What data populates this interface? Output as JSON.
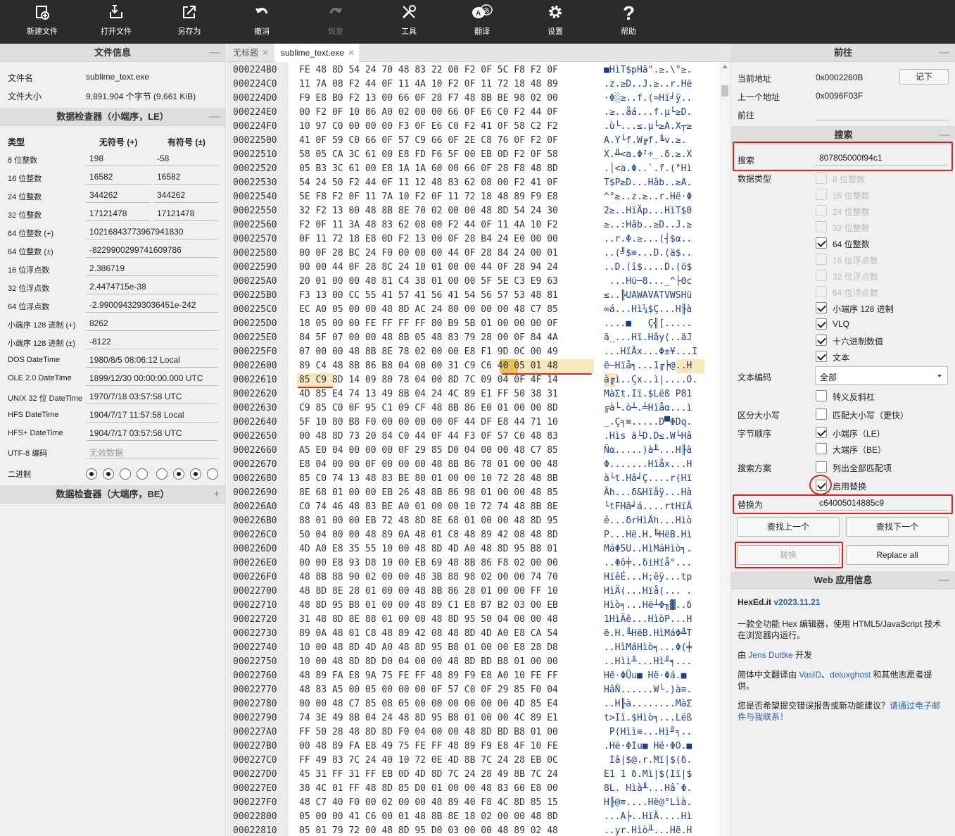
{
  "toolbar": {
    "new_file": "新建文件",
    "open_file": "打开文件",
    "save_as": "另存为",
    "undo": "撤消",
    "redo": "恢复",
    "tools": "工具",
    "translate": "翻译",
    "settings": "设置",
    "help": "帮助"
  },
  "file_info": {
    "title": "文件信息",
    "name_label": "文件名",
    "name_value": "sublime_text.exe",
    "size_label": "文件大小",
    "size_value": "9,891,904 个字节 (9,661 KiB)"
  },
  "inspector_le": {
    "title": "数据检查器（小端序，LE）",
    "col_type": "类型",
    "col_unsigned": "无符号 (+)",
    "col_signed": "有符号 (±)",
    "rows": [
      {
        "type": "8 位整数",
        "u": "198",
        "s": "-58"
      },
      {
        "type": "16 位整数",
        "u": "16582",
        "s": "16582"
      },
      {
        "type": "24 位整数",
        "u": "344262",
        "s": "344262"
      },
      {
        "type": "32 位整数",
        "u": "17121478",
        "s": "17121478"
      },
      {
        "type": "64 位整数 (+)",
        "w": "10216843773967941830"
      },
      {
        "type": "64 位整数 (±)",
        "w": "-8229900299741609786"
      },
      {
        "type": "16 位浮点数",
        "w": "2.386719"
      },
      {
        "type": "32 位浮点数",
        "w": "2.4474715e-38"
      },
      {
        "type": "64 位浮点数",
        "w": "-2.9900943293036451e-242"
      },
      {
        "type": "小端序 128 进制 (+)",
        "w": "8262"
      },
      {
        "type": "小端序 128 进制 (±)",
        "w": "-8122"
      },
      {
        "type": "DOS DateTime",
        "w": "1980/8/5 08:06:12 Local"
      },
      {
        "type": "OLE 2.0 DateTime",
        "w": "1899/12/30 00:00:00.000 UTC"
      },
      {
        "type": "UNIX 32 位 DateTime",
        "w": "1970/7/18 03:57:58 UTC"
      },
      {
        "type": "HFS DateTime",
        "w": "1904/7/17 11:57:58 Local"
      },
      {
        "type": "HFS+ DateTime",
        "w": "1904/7/17 03:57:58 UTC"
      },
      {
        "type": "UTF-8 编码",
        "w": "无效数据"
      }
    ],
    "binary_label": "二进制",
    "binary_bits": [
      1,
      1,
      0,
      0,
      0,
      1,
      1,
      0
    ]
  },
  "inspector_be": {
    "title": "数据检查器（大端序，BE）"
  },
  "tabs": [
    {
      "label": "无标题"
    },
    {
      "label": "sublime_text.exe"
    }
  ],
  "hex": {
    "rows": [
      {
        "addr": "000224B0",
        "bytes": "FE 48 8D 54 24 70 48 83 22 00 F2 0F 5C F8 F2 0F",
        "ascii": "■HìT$pHâ\".≥.\\°≥."
      },
      {
        "addr": "000224C0",
        "bytes": "11 7A 08 F2 44 0F 11 4A 10 F2 0F 11 72 18 48 89",
        "ascii": ".z.≥D..J.≥..r.Hë"
      },
      {
        "addr": "000224D0",
        "bytes": "F9 E8 B0 F2 13 00 66 0F 28 F7 48 8B BE 98 02 00",
        "ascii": "·Φ░≥..f.(≈Hï╛ÿ.."
      },
      {
        "addr": "000224E0",
        "bytes": "00 F2 0F 10 86 A0 02 00 00 66 0F E6 C0 F2 44 0F",
        "ascii": ".≥..åá...f.µ└≥D."
      },
      {
        "addr": "000224F0",
        "bytes": "10 97 C0 00 00 00 F3 0F E6 C0 F2 41 0F 58 C2 F2",
        "ascii": ".ù└...≤.µ└≥A.X┬≥"
      },
      {
        "addr": "00022500",
        "bytes": "41 0F 59 C0 66 0F 57 C9 66 0F 2E C8 76 0F F2 0F",
        "ascii": "A.Y└f.W╔f.╚v.≥."
      },
      {
        "addr": "00022510",
        "bytes": "58 05 CA 3C 61 00 E8 FD F6 5F 00 EB 0D F2 0F 58",
        "ascii": "X.╩<a.Φ²÷_.δ.≥.X"
      },
      {
        "addr": "00022520",
        "bytes": "05 B3 3C 61 00 E8 1A 1A 60 00 66 0F 28 F8 48 8D",
        "ascii": ".│<a.Φ..`.f.(°Hì"
      },
      {
        "addr": "00022530",
        "bytes": "54 24 50 F2 44 0F 11 12 48 83 62 08 00 F2 41 0F",
        "ascii": "T$P≥D...Hâb..≥A."
      },
      {
        "addr": "00022540",
        "bytes": "5E F8 F2 0F 11 7A 10 F2 0F 11 72 18 48 89 F9 E8",
        "ascii": "^°≥..z.≥..r.Hë·Φ"
      },
      {
        "addr": "00022550",
        "bytes": "32 F2 13 00 48 8B 8E 70 02 00 00 48 8D 54 24 30",
        "ascii": "2≥..HïÄp...HìT$0"
      },
      {
        "addr": "00022560",
        "bytes": "F2 0F 11 3A 48 83 62 08 00 F2 44 0F 11 4A 10 F2",
        "ascii": "≥..:Hâb..≥D..J.≥"
      },
      {
        "addr": "00022570",
        "bytes": "0F 11 72 18 E8 0D F2 13 00 0F 28 B4 24 E0 00 00",
        "ascii": "..r.Φ.≥...(┤$α.."
      },
      {
        "addr": "00022580",
        "bytes": "00 0F 28 BC 24 F0 00 00 00 44 0F 28 84 24 00 01",
        "ascii": "..(╝$≡...D.(ä$.."
      },
      {
        "addr": "00022590",
        "bytes": "00 00 44 0F 28 8C 24 10 01 00 00 44 0F 28 94 24",
        "ascii": "..D.(î$....D.(ö$"
      },
      {
        "addr": "000225A0",
        "bytes": "20 01 00 00 48 81 C4 38 01 00 00 5F 5E C3 E9 63",
        "ascii": " ...Hü─8..._^├Θc"
      },
      {
        "addr": "000225B0",
        "bytes": "F3 13 00 CC 55 41 57 41 56 41 54 56 57 53 48 81",
        "ascii": "≤..╠UAWAVATVWSHü"
      },
      {
        "addr": "000225C0",
        "bytes": "EC A0 05 00 00 48 8D AC 24 80 00 00 00 48 C7 85",
        "ascii": "∞á...Hì¼$Ç...H╟à"
      },
      {
        "addr": "000225D0",
        "bytes": "18 05 00 00 FE FF FF FF 80 B9 5B 01 00 00 00 0F",
        "ascii": "....■   Ç╣[....."
      },
      {
        "addr": "000225E0",
        "bytes": "84 5F 07 00 00 48 8B 05 48 83 79 28 00 0F 84 4A",
        "ascii": "ä_...Hï.Hây(..äJ"
      },
      {
        "addr": "000225F0",
        "bytes": "07 00 00 48 8B 8E 78 02 00 00 E8 F1 9D 0C 00 49",
        "ascii": "...HïÄx...Φ±¥...I"
      },
      {
        "addr": "00022600",
        "bytes": "89 C4 48 8B 86 B8 04 00 00 31 C9 C6 40 05 01 48",
        "ascii": "ë─Hïå╕...1╔╞@..H"
      },
      {
        "addr": "00022610",
        "bytes": "85 C9 8D 14 09 80 78 04 00 8D 7C 09 04 0F 4F 14",
        "ascii": "à╔ì..Çx..ì|....O."
      },
      {
        "addr": "00022620",
        "bytes": "4D 85 E4 74 13 49 8B 04 24 4C 89 E1 FF 50 38 31",
        "ascii": "MàΣt.Iï.$Lëß P81"
      },
      {
        "addr": "00022630",
        "bytes": "C9 85 C0 0F 95 C1 09 CF 48 8B 86 E0 01 00 00 8D",
        "ascii": "╔à└.ò┴.╧Hïåα...ì"
      },
      {
        "addr": "00022640",
        "bytes": "5F 10 80 B8 F0 00 00 00 00 0F 44 DF E8 44 71 10",
        "ascii": "_.Ç╕≡.....D▀ΦDq."
      },
      {
        "addr": "00022650",
        "bytes": "00 48 8D 73 20 84 C0 44 0F 44 F3 0F 57 C0 48 83",
        "ascii": ".Hìs ä└D.D≤.W└Hâ"
      },
      {
        "addr": "00022660",
        "bytes": "A5 E0 04 00 00 00 0F 29 85 D0 04 00 00 48 C7 85",
        "ascii": "Ñα.....)à╨...H╟à"
      },
      {
        "addr": "00022670",
        "bytes": "E8 04 00 00 0F 00 00 00 48 8B 86 78 01 00 00 48",
        "ascii": "Φ.......Hïåx...H"
      },
      {
        "addr": "00022680",
        "bytes": "85 C0 74 13 48 83 BE 80 01 00 00 10 72 28 48 8B",
        "ascii": "à└t.Hâ╛Ç....r(Hï"
      },
      {
        "addr": "00022690",
        "bytes": "8E 68 01 00 00 EB 26 48 8B 86 98 01 00 00 48 85",
        "ascii": "Äh...δ&Hïåÿ...Hà"
      },
      {
        "addr": "000226A0",
        "bytes": "C0 74 46 48 83 BE A0 01 00 00 10 72 74 48 8B 8E",
        "ascii": "└tFHâ╛á....rtHïÄ"
      },
      {
        "addr": "000226B0",
        "bytes": "88 01 00 00 EB 72 48 8D 8E 68 01 00 00 48 8D 95",
        "ascii": "ê...δrHìÄh...Hìò"
      },
      {
        "addr": "000226C0",
        "bytes": "50 04 00 00 48 89 0A 48 01 C8 48 89 42 08 48 8D",
        "ascii": "P...Hë.H.╚HëB.Hì"
      },
      {
        "addr": "000226D0",
        "bytes": "4D A0 E8 35 55 10 00 48 8D 4D A0 48 8D 95 B8 01",
        "ascii": "MáΦ5U..HìMáHìò╕."
      },
      {
        "addr": "000226E0",
        "bytes": "00 00 E8 93 D8 10 00 EB 69 48 8B 86 F8 02 00 00",
        "ascii": "..Φô╪..δiHïå°..."
      },
      {
        "addr": "000226F0",
        "bytes": "48 8B 88 90 02 00 00 48 3B 88 98 02 00 00 74 70",
        "ascii": "HïêÉ...H;êÿ...tp"
      },
      {
        "addr": "00022700",
        "bytes": "48 8D 8E 28 01 00 00 48 8B 86 28 01 00 00 FF 10",
        "ascii": "HìÄ(...Hïå(... ."
      },
      {
        "addr": "00022710",
        "bytes": "48 8D 95 B8 01 00 00 48 89 C1 E8 B7 B2 03 00 EB",
        "ascii": "Hìò╕...Hë┴Φ╖▓..δ"
      },
      {
        "addr": "00022720",
        "bytes": "31 48 8D 8E 88 01 00 00 48 8D 95 50 04 00 00 48",
        "ascii": "1HìÄê...HìòP...H"
      },
      {
        "addr": "00022730",
        "bytes": "89 0A 48 01 C8 48 89 42 08 48 8D 4D A0 E8 CA 54",
        "ascii": "ë.H.╚HëB.HìMáΦ╩T"
      },
      {
        "addr": "00022740",
        "bytes": "10 00 48 8D 4D A0 48 8D 95 B8 01 00 00 E8 28 D8",
        "ascii": "..HìMáHìò╕...Φ(╪"
      },
      {
        "addr": "00022750",
        "bytes": "10 00 48 8D 8D D0 04 00 00 48 8D BD B8 01 00 00",
        "ascii": "..Hìì╨...Hì╜╕..."
      },
      {
        "addr": "00022760",
        "bytes": "48 89 FA E8 9A 75 FE FF 48 89 F9 E8 A0 10 FE FF",
        "ascii": "Hë·ΦÜu■ Hë·Φá.■ "
      },
      {
        "addr": "00022770",
        "bytes": "48 83 A5 00 05 00 00 00 0F 57 C0 0F 29 85 F0 04",
        "ascii": "HâÑ......W└.)à≡."
      },
      {
        "addr": "00022780",
        "bytes": "00 00 48 C7 85 08 05 00 00 00 00 00 00 4D 85 E4",
        "ascii": "..H╟à........MàΣ"
      },
      {
        "addr": "00022790",
        "bytes": "74 3E 49 8B 04 24 48 8D 95 B8 01 00 00 4C 89 E1",
        "ascii": "t>Iï.$Hìò╕...Lëß"
      },
      {
        "addr": "000227A0",
        "bytes": "FF 50 28 48 8D 8D F0 04 00 00 48 8D BD B8 01 00",
        "ascii": " P(Hìì≡...Hì╜╕.."
      },
      {
        "addr": "000227B0",
        "bytes": "00 48 89 FA E8 49 75 FE FF 48 89 F9 E8 4F 10 FE",
        "ascii": ".Hë·ΦIu■ Hë·ΦO.■"
      },
      {
        "addr": "000227C0",
        "bytes": "FF 49 83 7C 24 40 10 72 0E 4D 8B 7C 24 28 EB 0C",
        "ascii": " Iâ|$@.r.Mï|$(δ."
      },
      {
        "addr": "000227D0",
        "bytes": "45 31 FF 31 FF EB 0D 4D 8D 7C 24 28 49 8B 7C 24",
        "ascii": "E1 1 δ.Mì|$(Iï|$"
      },
      {
        "addr": "000227E0",
        "bytes": "38 4C 01 FF 48 8D 85 D0 01 00 00 48 83 60 E8 00",
        "ascii": "8L. Hìà╨...Hâ`Φ."
      },
      {
        "addr": "000227F0",
        "bytes": "48 C7 40 F0 00 02 00 00 48 89 40 F8 4C 8D 85 15",
        "ascii": "H╟@≡....Hë@°Lìà."
      },
      {
        "addr": "00022800",
        "bytes": "05 00 00 41 C6 00 01 48 8B 8E 18 02 00 00 48 8D",
        "ascii": "...A╞..HïÄ....Hì"
      },
      {
        "addr": "00022810",
        "bytes": "05 01 79 72 00 48 8D 95 D0 03 00 00 48 89 02 48",
        "ascii": "..yr.Hìò╨...Hë.H"
      }
    ]
  },
  "goto": {
    "title": "前往",
    "current_label": "当前地址",
    "current_value": "0x0002260B",
    "remember_btn": "记下",
    "prev_label": "上一个地址",
    "prev_value": "0x0096F03F",
    "goto_label": "前往",
    "goto_value": ""
  },
  "search": {
    "title": "搜索",
    "search_label": "搜索",
    "search_value": "807805000f94c1",
    "datatype_label": "数据类型",
    "types": [
      {
        "label": "8 位整数",
        "checked": false,
        "disabled": true
      },
      {
        "label": "16 位整数",
        "checked": false,
        "disabled": true
      },
      {
        "label": "24 位整数",
        "checked": false,
        "disabled": true
      },
      {
        "label": "32 位整数",
        "checked": false,
        "disabled": true
      },
      {
        "label": "64 位整数",
        "checked": true,
        "disabled": false
      },
      {
        "label": "16 位浮点数",
        "checked": false,
        "disabled": true
      },
      {
        "label": "32 位浮点数",
        "checked": false,
        "disabled": true
      },
      {
        "label": "64 位浮点数",
        "checked": false,
        "disabled": true
      },
      {
        "label": "小端序 128 进制",
        "checked": true,
        "disabled": false
      },
      {
        "label": "VLQ",
        "checked": true,
        "disabled": false
      },
      {
        "label": "十六进制数值",
        "checked": true,
        "disabled": false
      },
      {
        "label": "文本",
        "checked": true,
        "disabled": false
      }
    ],
    "encoding_label": "文本编码",
    "encoding_value": "全部",
    "escape_label": "转义反斜杠",
    "case_label": "区分大小写",
    "case_option": "匹配大小写（更快）",
    "byteorder_label": "字节顺序",
    "le_option": "小端序（LE）",
    "be_option": "大端序（BE）",
    "scheme_label": "搜索方案",
    "list_all_option": "列出全部匹配项",
    "enable_replace_option": "启用替换",
    "replace_label": "替换为",
    "replace_value": "c64005014885c9",
    "find_prev_btn": "查找上一个",
    "find_next_btn": "查找下一个",
    "replace_btn": "替换",
    "replace_all_btn": "Replace all"
  },
  "webinfo": {
    "title": "Web 应用信息",
    "app_name": "HexEd.it",
    "version": "v2023.11.21",
    "desc": "一款全功能 Hex 编辑器，使用 HTML5/JavaScript 技术在浏览器内运行。",
    "by_prefix": "由 ",
    "author": "Jens Duttke",
    "by_suffix": " 开发",
    "trans_prefix": "简体中文翻译由 ",
    "trans_1": "VasID",
    "trans_sep": "、",
    "trans_2": "deluxghost",
    "trans_suffix": " 和其他志愿者提供。",
    "feedback_prefix": "您是否希望提交错误报告或新功能建议？",
    "feedback_link": "请通过电子邮件与我联系！"
  },
  "colors": {
    "toolbar_bg": "#2b2b2b",
    "highlight": "#f7e7bd",
    "cursor": "#e6c15a",
    "annotation_red": "#d9261c",
    "link_blue": "#2663b5"
  }
}
